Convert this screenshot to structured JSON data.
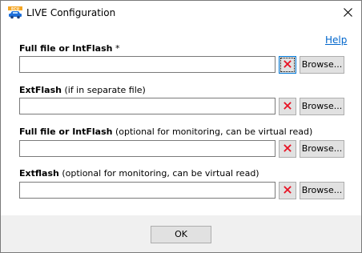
{
  "window": {
    "title": "LIVE Configuration",
    "app_icon": "car-ecu-icon",
    "close_icon": "close-icon"
  },
  "help": {
    "label": "Help"
  },
  "rows": [
    {
      "label_bold": "Full file or IntFlash",
      "label_rest": " *",
      "value": "",
      "clear_icon": "red-x-icon",
      "browse_label": "Browse..."
    },
    {
      "label_bold": "ExtFlash",
      "label_rest": " (if in separate file)",
      "value": "",
      "clear_icon": "red-x-icon",
      "browse_label": "Browse..."
    },
    {
      "label_bold": "Full file or IntFlash",
      "label_rest": " (optional for monitoring, can be virtual read)",
      "value": "",
      "clear_icon": "red-x-icon",
      "browse_label": "Browse..."
    },
    {
      "label_bold": "Extflash",
      "label_rest": " (optional for monitoring, can be virtual read)",
      "value": "",
      "clear_icon": "red-x-icon",
      "browse_label": "Browse..."
    }
  ],
  "footer": {
    "ok_label": "OK"
  },
  "colors": {
    "link": "#0066cc",
    "clear_x": "#e81123",
    "footer_bg": "#f0f0f0",
    "button_bg": "#e1e1e1",
    "icon_blue": "#1e6fd9",
    "icon_orange": "#f5a623"
  }
}
